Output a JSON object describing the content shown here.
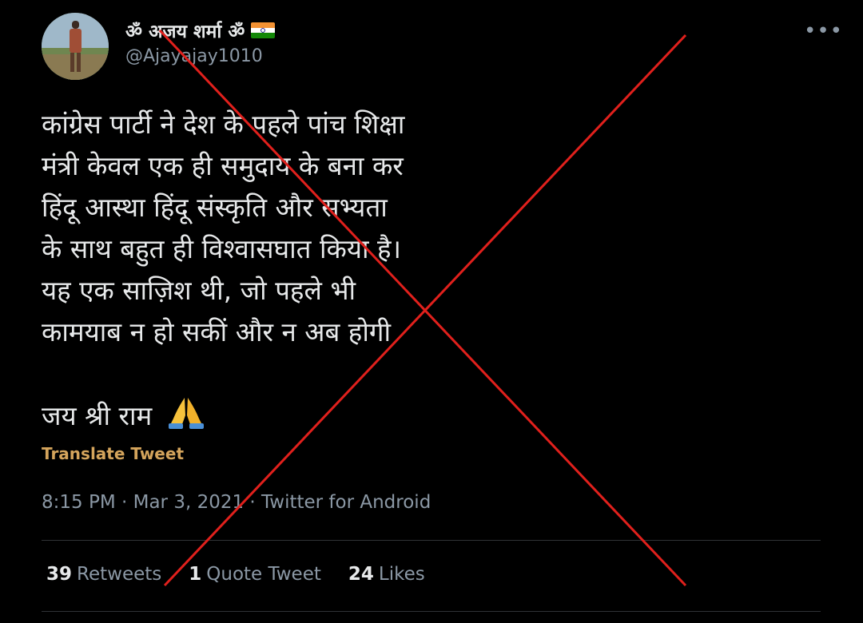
{
  "author": {
    "display_name": "ॐ अजय शर्मा ॐ",
    "handle": "@Ajayajay1010",
    "flag_icon": "india-flag-icon"
  },
  "menu": {
    "more_icon": "more-options-icon",
    "more_glyph": "•••"
  },
  "tweet": {
    "lines": [
      "कांग्रेस पार्टी ने देश के पहले पांच शिक्षा",
      "मंत्री केवल एक ही समुदाय के बना कर",
      "हिंदू आस्था हिंदू संस्कृति और सभ्यता",
      "के साथ बहुत ही विश्वासघात किया है।",
      "यह एक साज़िश थी, जो पहले भी",
      "कामयाब न हो सकीं और न अब होगी"
    ],
    "closing": "जय श्री राम",
    "closing_icon": "folded-hands-icon"
  },
  "translate_label": "Translate Tweet",
  "meta": {
    "text": "8:15 PM · Mar 3, 2021 · Twitter for Android"
  },
  "stats": {
    "retweets_count": "39",
    "retweets_label": "Retweets",
    "quote_count": "1",
    "quote_label": "Quote Tweet",
    "likes_count": "24",
    "likes_label": "Likes"
  },
  "colors": {
    "background": "#000000",
    "text": "#e7e9ea",
    "secondary": "#8b98a5",
    "translate_link": "#d4a45c",
    "overlay_cross": "#e0201c"
  },
  "overlay": {
    "type": "red-x-cross-mark"
  }
}
